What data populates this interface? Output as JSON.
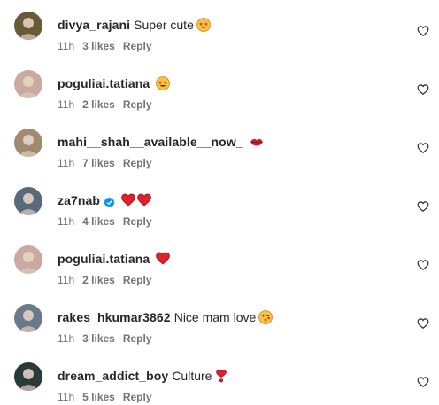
{
  "comments": [
    {
      "username": "divya_rajani",
      "text": "Super cute",
      "emoji": "star-struck-emoji",
      "time": "11h",
      "likes": "3 likes",
      "reply": "Reply",
      "verified": false,
      "avatar_color": "#6b5a3a"
    },
    {
      "username": "poguliai.tatiana",
      "text": "",
      "emoji": "star-struck-emoji",
      "time": "11h",
      "likes": "2 likes",
      "reply": "Reply",
      "verified": false,
      "avatar_color": "#c9a9a0"
    },
    {
      "username": "mahi__shah__available__now_",
      "text": "",
      "emoji": "lips-emoji",
      "time": "11h",
      "likes": "7 likes",
      "reply": "Reply",
      "verified": false,
      "avatar_color": "#a08a70"
    },
    {
      "username": "za7nab",
      "text": "",
      "emoji": "two-red-hearts-emoji",
      "time": "11h",
      "likes": "4 likes",
      "reply": "Reply",
      "verified": true,
      "avatar_color": "#5a6a7a"
    },
    {
      "username": "poguliai.tatiana",
      "text": "",
      "emoji": "red-heart-emoji",
      "time": "11h",
      "likes": "2 likes",
      "reply": "Reply",
      "verified": false,
      "avatar_color": "#c9a9a0"
    },
    {
      "username": "rakes_hkumar3862",
      "text": "Nice mam love",
      "emoji": "kissing-face-emoji",
      "time": "11h",
      "likes": "3 likes",
      "reply": "Reply",
      "verified": false,
      "avatar_color": "#6a7a8a"
    },
    {
      "username": "dream_addict_boy",
      "text": "Culture",
      "emoji": "heart-exclamation-emoji",
      "time": "11h",
      "likes": "5 likes",
      "reply": "Reply",
      "verified": false,
      "avatar_color": "#2a3a3a"
    }
  ],
  "colors": {
    "username": "#262626",
    "meta": "#737373",
    "heart": "#ed4956",
    "verified": "#0095f6"
  },
  "icons": {
    "like": "heart-outline-icon",
    "verified": "verified-badge-icon"
  }
}
